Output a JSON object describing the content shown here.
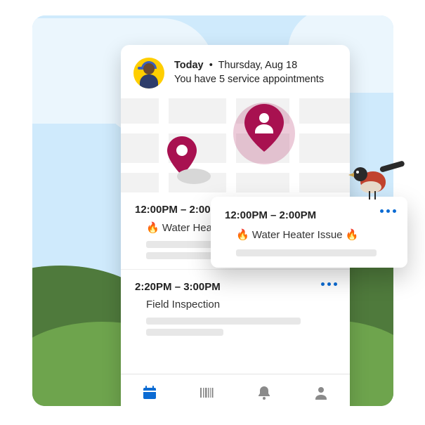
{
  "header": {
    "today_label": "Today",
    "dot": "•",
    "date": "Thursday, Aug 18",
    "summary": "You have 5 service appointments"
  },
  "appointments": [
    {
      "time": "12:00PM – 2:00PM",
      "title": "🔥 Water Heater Issue 🔥"
    },
    {
      "time": "2:20PM – 3:00PM",
      "title": "Field Inspection"
    }
  ],
  "popout": {
    "time": "12:00PM – 2:00PM",
    "title": "🔥 Water Heater Issue 🔥"
  },
  "truncated": {
    "appt0_title": "🔥 Water Heate"
  },
  "icons": {
    "map_pin": "map-pin-icon",
    "person_pin": "person-pin-icon",
    "calendar": "calendar-icon",
    "barcode": "barcode-icon",
    "bell": "bell-icon",
    "profile": "profile-icon",
    "more": "more-icon"
  },
  "colors": {
    "accent": "#0b6bd3",
    "pin": "#a81150",
    "avatar_bg": "#ffce00"
  }
}
